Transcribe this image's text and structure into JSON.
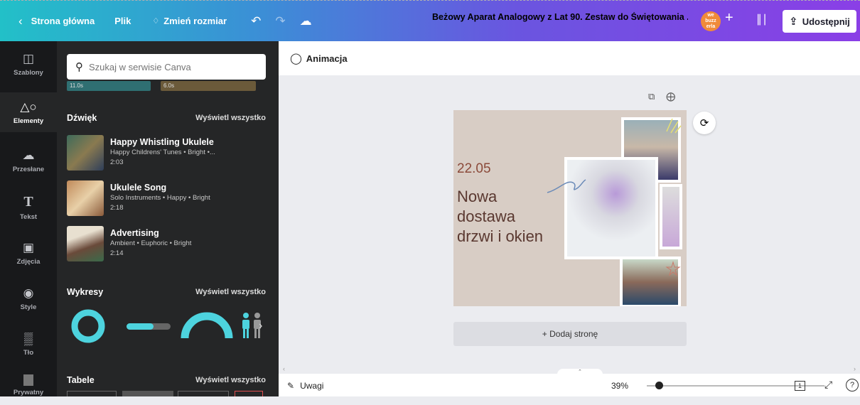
{
  "topbar": {
    "back_label": "Strona główna",
    "file_label": "Plik",
    "resize_label": "Zmień rozmiar",
    "title": "Beżowy Aparat Analogowy z Lat 90. Zestaw do Świętowania ...",
    "avatar_text": "we buzz erla",
    "share_label": "Udostępnij"
  },
  "rail": {
    "items": [
      {
        "label": "Szablony",
        "icon": "template-icon"
      },
      {
        "label": "Elementy",
        "icon": "elements-icon"
      },
      {
        "label": "Przesłane",
        "icon": "upload-icon"
      },
      {
        "label": "Tekst",
        "icon": "text-icon"
      },
      {
        "label": "Zdjęcia",
        "icon": "photo-icon"
      },
      {
        "label": "Style",
        "icon": "palette-icon"
      },
      {
        "label": "Tło",
        "icon": "background-icon"
      },
      {
        "label": "Prywatny",
        "icon": "private-icon"
      }
    ]
  },
  "panel": {
    "search_placeholder": "Szukaj w serwisie Canva",
    "video_thumbs": [
      "11.0s",
      "6.0s"
    ],
    "sound_section": {
      "title": "Dźwięk",
      "link": "Wyświetl wszystko",
      "tracks": [
        {
          "name": "Happy Whistling Ukulele",
          "meta": "Happy Childrens' Tunes • Bright •...",
          "duration": "2:03"
        },
        {
          "name": "Ukulele Song",
          "meta": "Solo Instruments • Happy • Bright",
          "duration": "2:18"
        },
        {
          "name": "Advertising",
          "meta": "Ambient • Euphoric • Bright",
          "duration": "2:14"
        }
      ]
    },
    "charts_section": {
      "title": "Wykresy",
      "link": "Wyświetl wszystko"
    },
    "tables_section": {
      "title": "Tabele",
      "link": "Wyświetl wszystko"
    }
  },
  "canvas": {
    "toolbar_label": "Animacja",
    "date": "22.05",
    "headline_lines": [
      "Nowa",
      "dostawa",
      "drzwi i okien"
    ],
    "add_page_label": "+ Dodaj stronę"
  },
  "bottombar": {
    "notes_label": "Uwagi",
    "zoom_label": "39%",
    "zoom_value": 0.39,
    "page_count": "1"
  },
  "colors": {
    "accent_gradient_start": "#22c0c8",
    "accent_gradient_end": "#8a3fe6",
    "panel_bg": "#252627",
    "rail_bg": "#18191b",
    "chart_accent": "#4dd3de",
    "page_bg": "#d8cdc5"
  }
}
